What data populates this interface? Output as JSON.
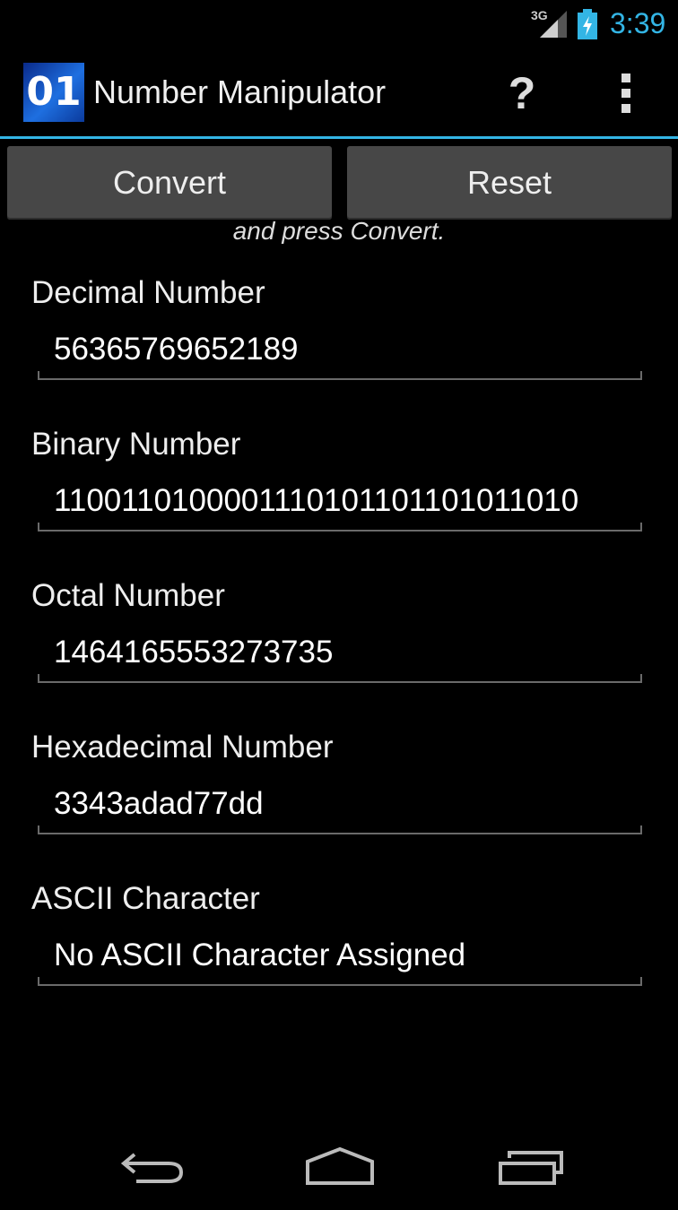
{
  "status_bar": {
    "network": "3G",
    "time": "3:39"
  },
  "action_bar": {
    "logo_text": "01",
    "title": "Number Manipulator",
    "help_label": "?"
  },
  "buttons": {
    "convert": "Convert",
    "reset": "Reset"
  },
  "instruction_partial": "and press Convert.",
  "fields": [
    {
      "label": "Decimal Number",
      "value": "56365769652189"
    },
    {
      "label": "Binary Number",
      "value": "1100110100001110101101101011010"
    },
    {
      "label": "Octal Number",
      "value": "1464165553273735"
    },
    {
      "label": "Hexadecimal Number",
      "value": "3343adad77dd"
    },
    {
      "label": "ASCII Character",
      "value": "No ASCII Character Assigned"
    }
  ],
  "icons": {
    "signal": "signal-icon",
    "battery": "battery-charging-icon",
    "help": "help-icon",
    "overflow": "overflow-menu-icon",
    "back": "back-icon",
    "home": "home-icon",
    "recents": "recent-apps-icon"
  },
  "colors": {
    "accent": "#33b5e5",
    "background": "#000000",
    "button": "#474747"
  }
}
